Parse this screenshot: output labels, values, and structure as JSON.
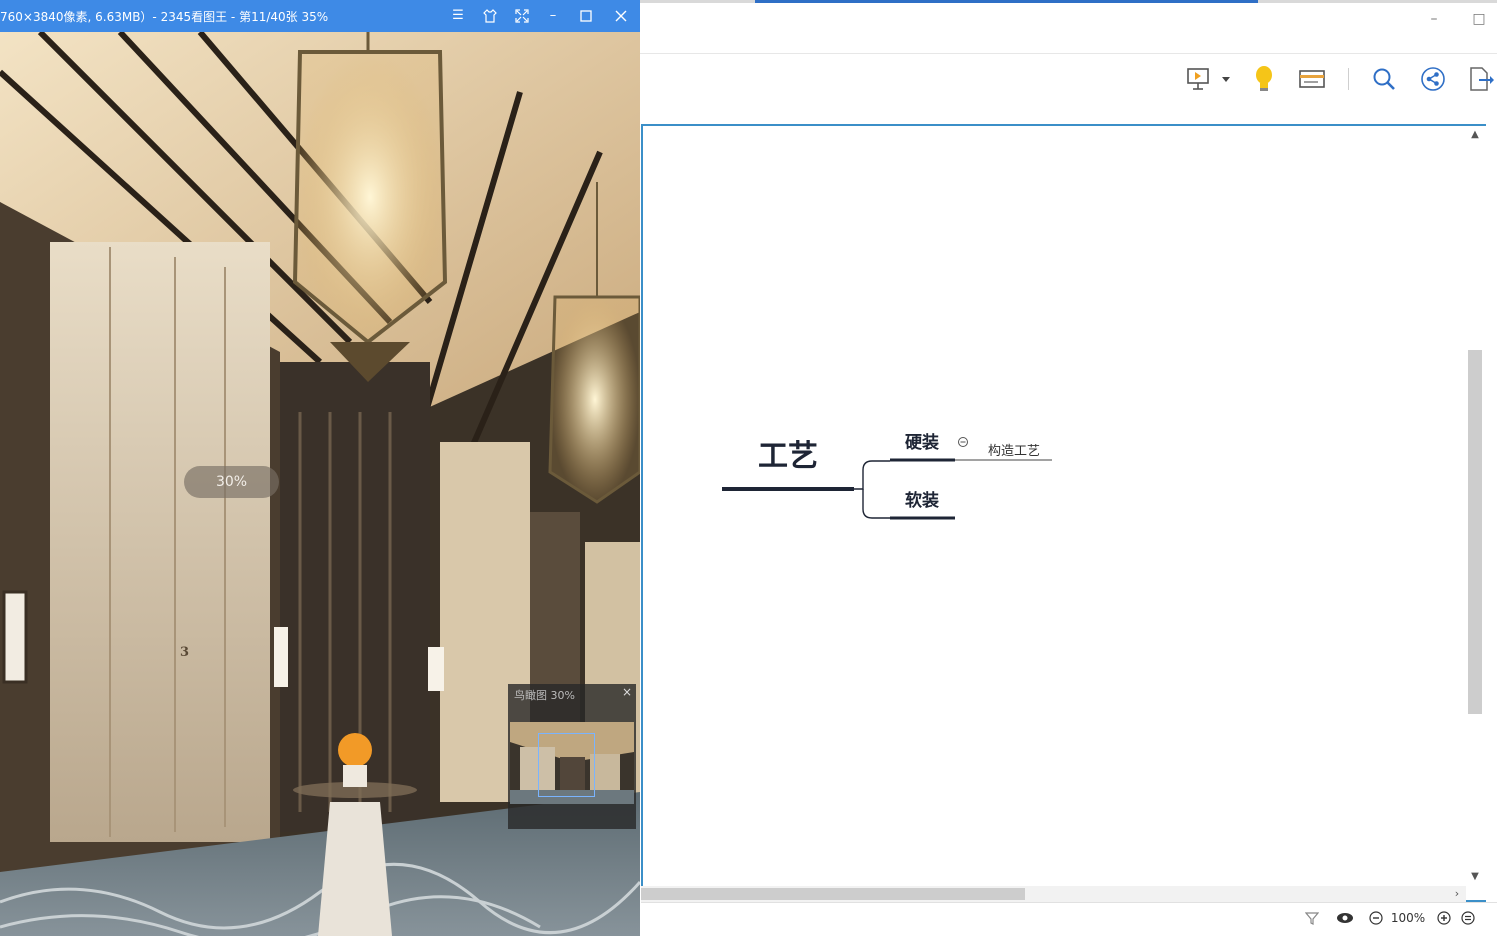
{
  "viewer": {
    "title": "760×3840像素, 6.63MB）- 2345看图王 - 第11/40张 35%",
    "zoom_bubble": "30%",
    "navigator_title": "鸟瞰图 30%",
    "navigator_close": "×",
    "titlebar_color": "#3e8ae6"
  },
  "mindmap": {
    "central_topic": "工艺",
    "branches": [
      {
        "label": "硬装",
        "collapse_icon": "collapse-circle-icon"
      },
      {
        "label": "软装"
      }
    ],
    "subtopics": [
      "构造工艺"
    ],
    "line_color": "#1e2535"
  },
  "window": {
    "minimize": "–",
    "maximize": "□"
  },
  "toolbar": {
    "icons": [
      "presentation-icon",
      "dropdown-arrow-icon",
      "lightbulb-icon",
      "card-icon",
      "search-icon",
      "share-icon",
      "export-icon"
    ]
  },
  "statusbar": {
    "zoom": "100%",
    "icons": [
      "filter-icon",
      "eye-icon",
      "zoom-out-icon",
      "zoom-in-icon",
      "menu-icon"
    ]
  },
  "colors": {
    "accent": "#2f6fc6",
    "canvas_border": "#3b8fc8"
  }
}
